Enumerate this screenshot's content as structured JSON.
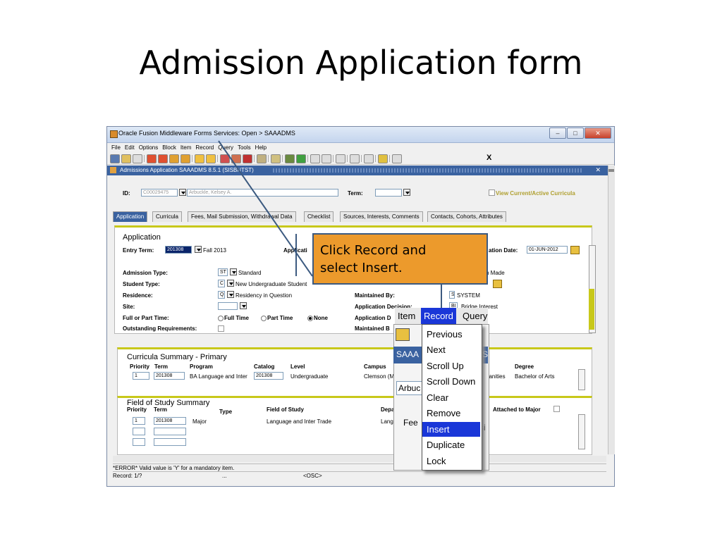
{
  "slide": {
    "title": "Admission Application form"
  },
  "window": {
    "title": "Oracle Fusion Middleware Forms Services:  Open > SAAADMS",
    "menu": [
      "File",
      "Edit",
      "Options",
      "Block",
      "Item",
      "Record",
      "Query",
      "Tools",
      "Help"
    ],
    "toolbar_exit": "X",
    "form_title": "Admissions Application  SAAADMS  8.5.1  (SISBNTST)"
  },
  "key_block": {
    "id_label": "ID:",
    "id_value": "C00029475",
    "name_value": "Arbuckle, Kelsey A.",
    "term_label": "Term:",
    "term_value": "",
    "view_curricula": "View Current/Active Curricula"
  },
  "tabs": [
    "Application",
    "Curricula",
    "Fees, Mail Submission, Withdrawal Data",
    "Checklist",
    "Sources, Interests, Comments",
    "Contacts, Cohorts, Attributes"
  ],
  "application": {
    "header": "Application",
    "entry_term_label": "Entry Term:",
    "entry_term_value": "201308",
    "entry_term_desc": "Fall 2013",
    "applicati_label": "Applicati",
    "app_date_label": "ation Date:",
    "app_date_value": "01-JUN-2012",
    "admission_type_label": "Admission Type:",
    "admission_type_code": "ST",
    "admission_type_desc": "Standard",
    "student_type_label": "Student Type:",
    "student_type_code": "C",
    "student_type_desc": "New Undergraduate Student",
    "residence_label": "Residence:",
    "residence_code": "Q",
    "residence_desc": "Residency in Question",
    "site_label": "Site:",
    "full_part_label": "Full or Part Time:",
    "full_time": "Full Time",
    "part_time": "Part Time",
    "none": "None",
    "outstanding_label": "Outstanding Requirements:",
    "made_text": "n Made",
    "maintained_by_label": "Maintained By:",
    "maintained_by_code": "S",
    "maintained_by_desc": "SYSTEM",
    "decision_label": "Application Decision:",
    "decision_code": "BI",
    "decision_desc": "Bridge Interest",
    "app_d_label": "Application D",
    "maintained_b_label": "Maintained B"
  },
  "curricula": {
    "title": "Curricula Summary   - Primary",
    "columns": [
      "Priority",
      "Term",
      "Program",
      "Catalog",
      "Level",
      "Campus",
      "Degree"
    ],
    "row": {
      "priority": "1",
      "term": "201308",
      "program": "BA Language and Inter",
      "catalog": "201308",
      "level": "Undergraduate",
      "campus": "Clemson (M",
      "college_frag": "nanities",
      "degree": "Bachelor of Arts"
    }
  },
  "field_of_study": {
    "title": "Field of Study Summary",
    "columns": [
      "Priority",
      "Term",
      "Type",
      "Field of Study",
      "Depa",
      "Attached to Major"
    ],
    "row": {
      "priority": "1",
      "term": "201308",
      "type": "Major",
      "field": "Language and Inter Trade",
      "dept": "Lang"
    }
  },
  "status": {
    "message": "*ERROR* Valid value is 'Y' for a mandatory item.",
    "record": "Record: 1/?",
    "dots": "...",
    "osc": "<OSC>"
  },
  "callout": {
    "text": "Click Record and select Insert."
  },
  "zoom_menu": {
    "bar": [
      "Item",
      "Record",
      "Query"
    ],
    "items": [
      "Previous",
      "Next",
      "Scroll Up",
      "Scroll Down",
      "Clear",
      "Remove",
      "Insert",
      "Duplicate",
      "Lock"
    ],
    "highlighted": "Insert",
    "fragments": {
      "saa": "SAAA",
      "s": "S",
      "arbuc": "Arbuc",
      "fee": "Fee",
      "si": "si"
    }
  }
}
